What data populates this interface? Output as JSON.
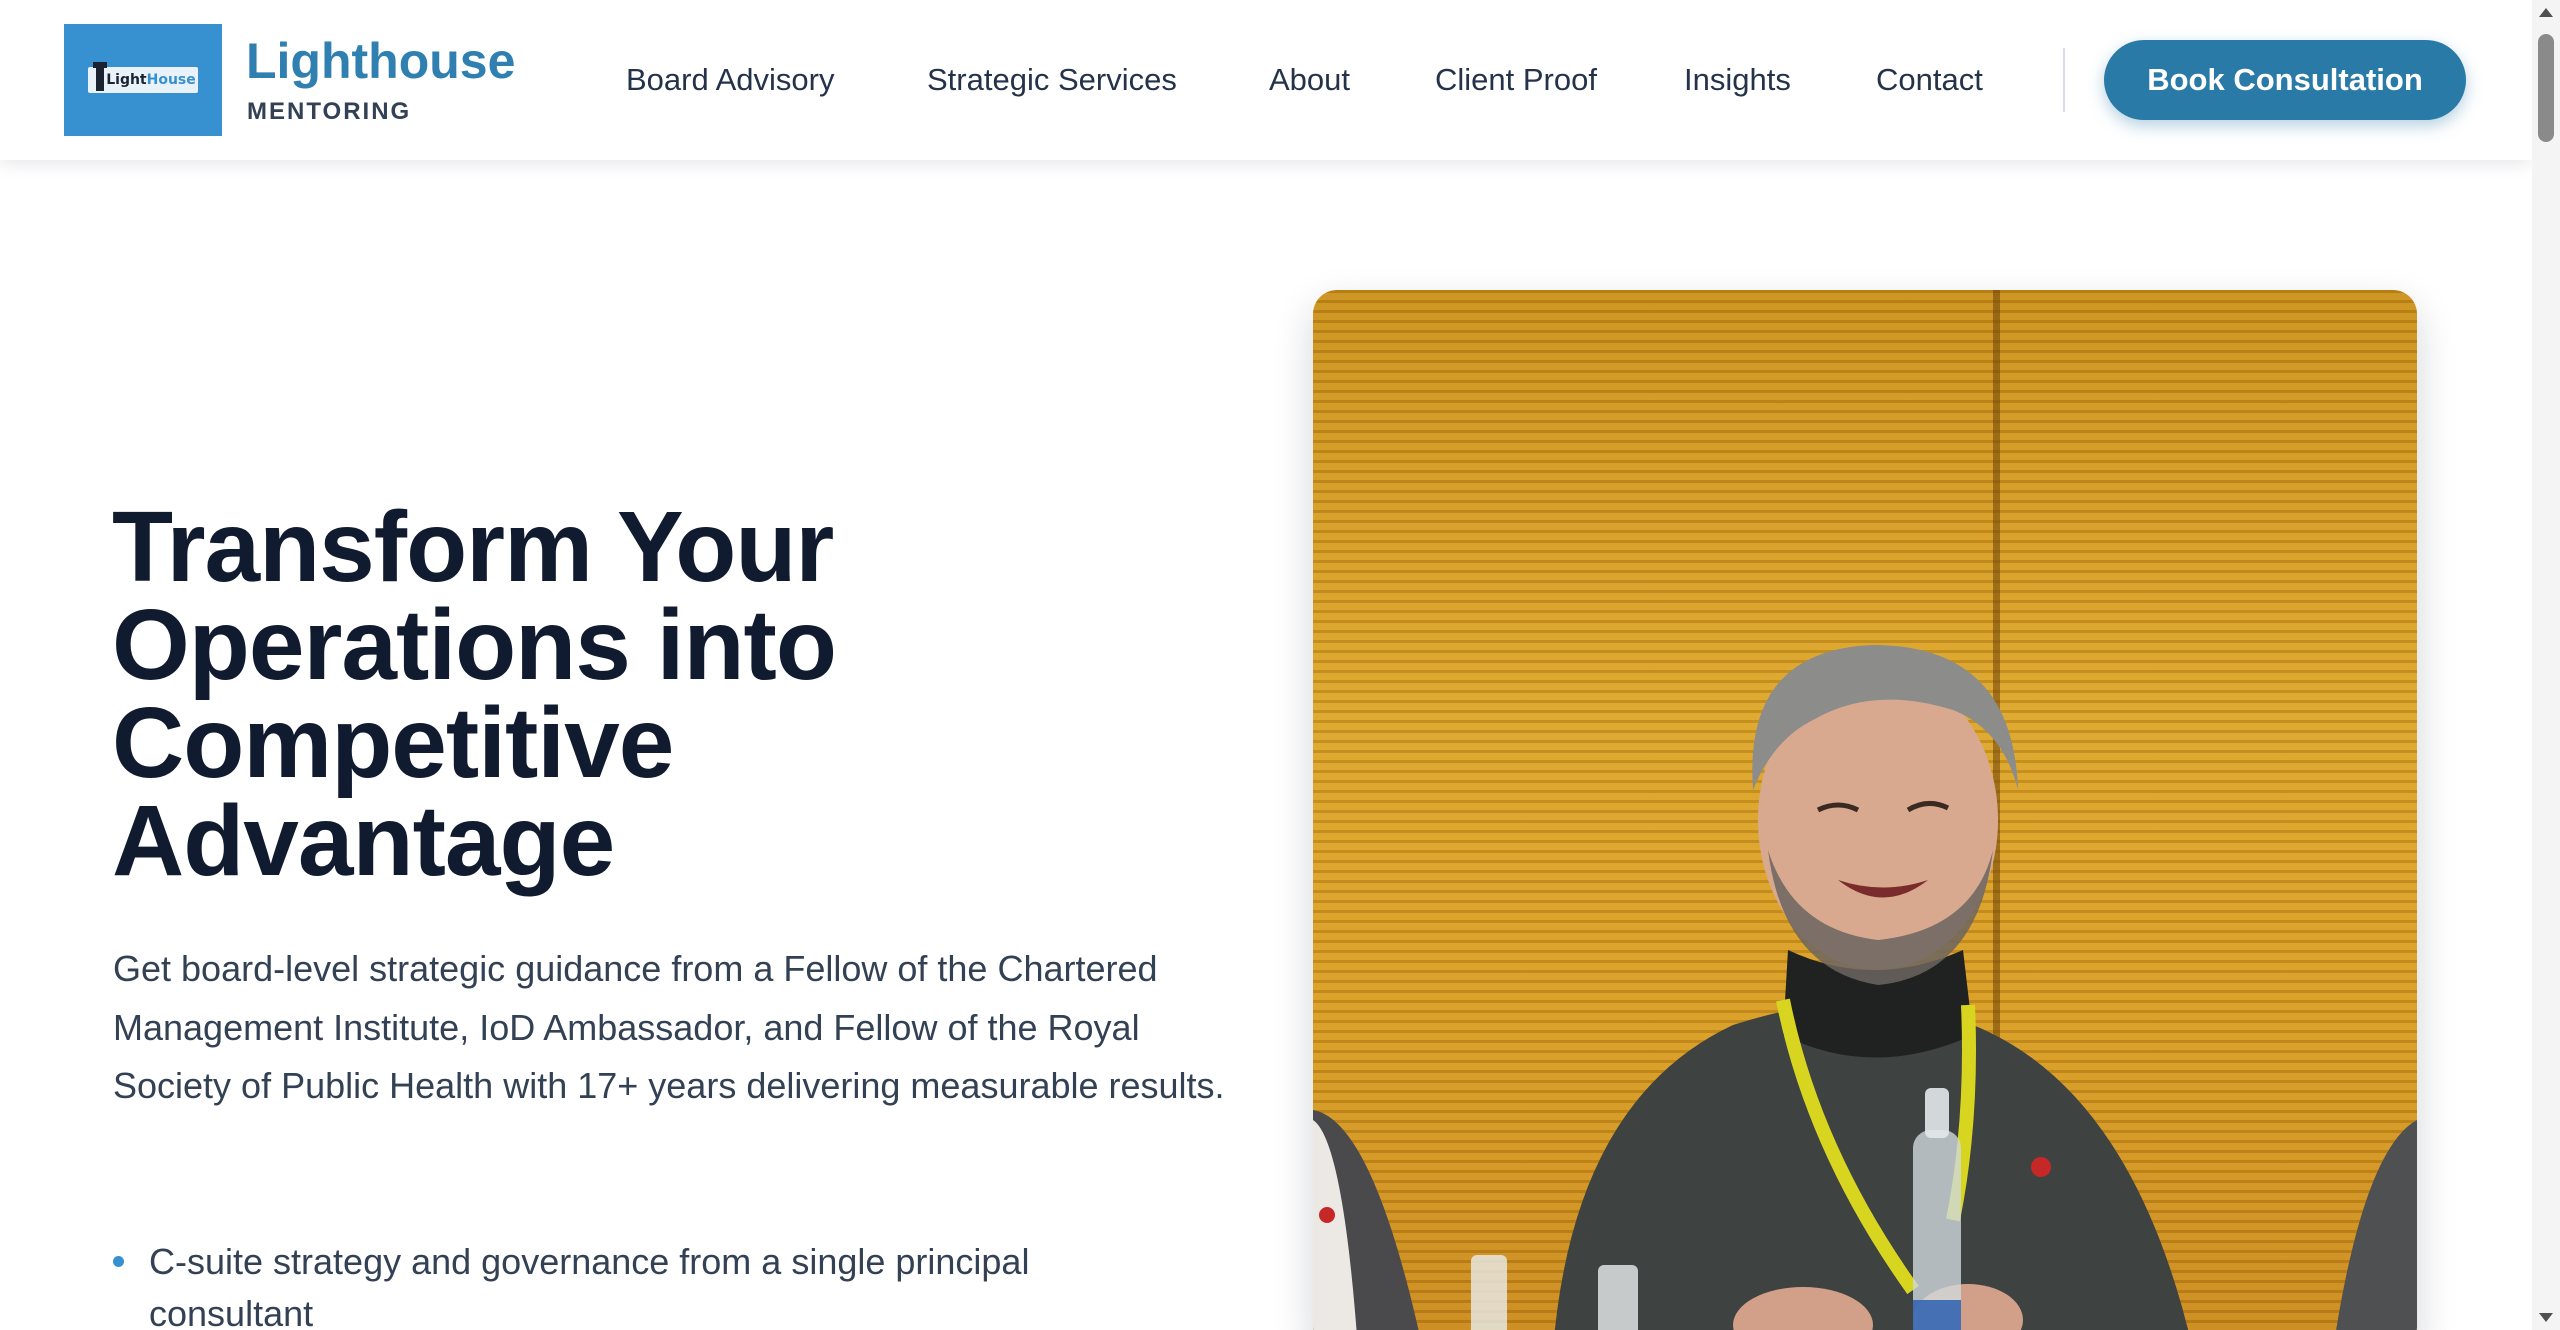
{
  "brand": {
    "logo_text_a": "Light",
    "logo_text_b": "House",
    "name": "Lighthouse",
    "subtitle": "MENTORING"
  },
  "nav": {
    "items": [
      "Board Advisory",
      "Strategic Services",
      "About",
      "Client Proof",
      "Insights",
      "Contact"
    ],
    "cta": "Book Consultation"
  },
  "hero": {
    "title_lines": [
      "Transform Your",
      "Operations into",
      "Competitive",
      "Advantage"
    ],
    "description": "Get board-level strategic guidance from a Fellow of the Chartered Management Institute, IoD Ambassador, and Fellow of the Royal Society of Public Health with 17+ years delivering measurable results.",
    "bullets": [
      "C-suite strategy and governance from a single principal consultant"
    ]
  },
  "photo": {
    "icon": "portrait-photo"
  },
  "colors": {
    "brand_blue": "#2f7fb0",
    "cta_blue": "#2a7aa8",
    "logo_bg": "#3790cf",
    "heading": "#111b30",
    "body_text": "#334155"
  }
}
